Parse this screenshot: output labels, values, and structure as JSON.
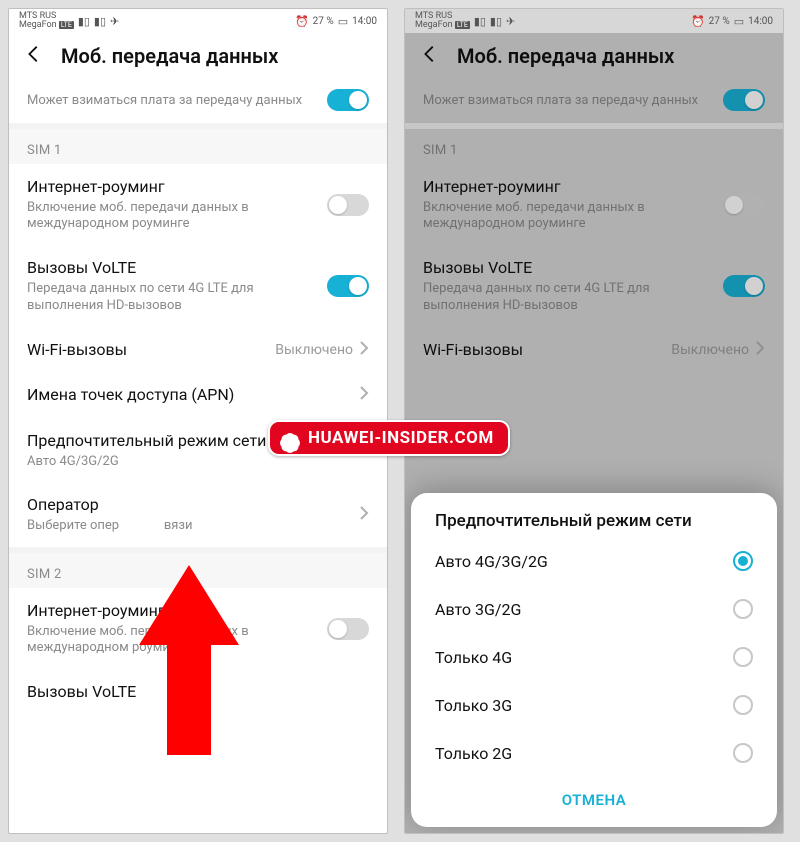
{
  "status": {
    "carrier1": "MTS RUS",
    "carrier2": "MegaFon",
    "battery": "27 %",
    "time": "14:00"
  },
  "header": {
    "title": "Моб. передача данных"
  },
  "topToggle": {
    "sub": "Может взиматься плата за передачу данных",
    "on": true
  },
  "section1": "SIM 1",
  "section2": "SIM 2",
  "roaming": {
    "title": "Интернет-роуминг",
    "sub": "Включение моб. передачи данных в международном роуминге",
    "on": false
  },
  "volte": {
    "title": "Вызовы VoLTE",
    "sub": "Передача данных по сети 4G LTE для выполнения HD-вызовов",
    "on": true
  },
  "wifiCalls": {
    "title": "Wi-Fi-вызовы",
    "value": "Выключено"
  },
  "apn": {
    "title": "Имена точек доступа (APN)"
  },
  "netmode": {
    "title": "Предпочтительный режим сети",
    "sub": "Авто 4G/3G/2G"
  },
  "operator": {
    "title": "Оператор",
    "sub_left": "Выберите опер",
    "sub_right": "вязи"
  },
  "volte2": {
    "title": "Вызовы VoLTE"
  },
  "dialog": {
    "title": "Предпочтительный режим сети",
    "options": [
      {
        "label": "Авто 4G/3G/2G",
        "selected": true
      },
      {
        "label": "Авто 3G/2G",
        "selected": false
      },
      {
        "label": "Только 4G",
        "selected": false
      },
      {
        "label": "Только 3G",
        "selected": false
      },
      {
        "label": "Только 2G",
        "selected": false
      }
    ],
    "cancel": "ОТМЕНА"
  },
  "watermark": "HUAWEI-INSIDER.COM"
}
